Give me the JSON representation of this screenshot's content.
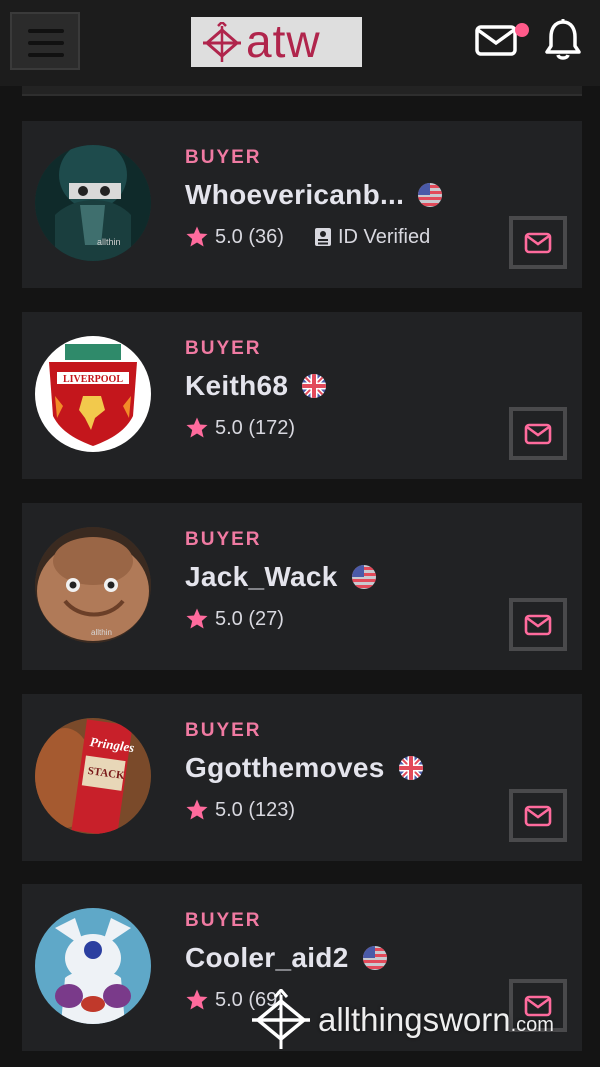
{
  "header": {
    "logo_text": "atw",
    "has_notification": true
  },
  "colors": {
    "accent": "#f07aa2",
    "background": "#141414",
    "card": "#212224",
    "logo_text": "#b0254c"
  },
  "buyers": [
    {
      "role": "BUYER",
      "name": "Whoevericanb...",
      "flag": "us-flag-icon",
      "rating": "5.0",
      "reviews": "(36)",
      "verified_label": "ID Verified"
    },
    {
      "role": "BUYER",
      "name": "Keith68",
      "flag": "uk-flag-icon",
      "rating": "5.0",
      "reviews": "(172)"
    },
    {
      "role": "BUYER",
      "name": "Jack_Wack",
      "flag": "us-flag-icon",
      "rating": "5.0",
      "reviews": "(27)"
    },
    {
      "role": "BUYER",
      "name": "Ggotthemoves",
      "flag": "uk-flag-icon",
      "rating": "5.0",
      "reviews": "(123)"
    },
    {
      "role": "BUYER",
      "name": "Cooler_aid2",
      "flag": "us-flag-icon",
      "rating": "5.0",
      "reviews": "(69)"
    }
  ],
  "watermark": {
    "text": "allthingsworn",
    "suffix": ".com"
  }
}
